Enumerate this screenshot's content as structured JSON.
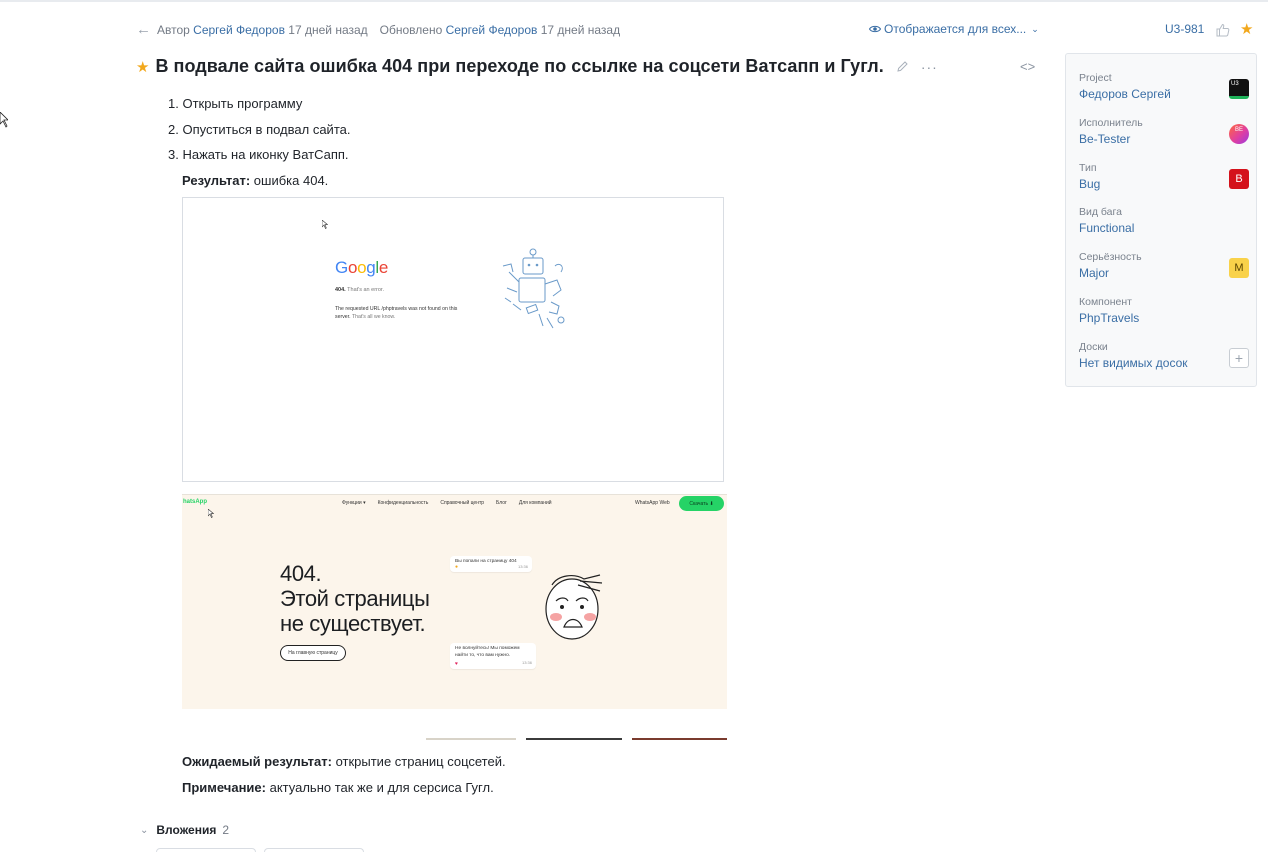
{
  "header": {
    "author_prefix": "Автор",
    "author_name": "Сергей Федоров",
    "author_time": "17 дней назад",
    "updated_prefix": "Обновлено",
    "updated_name": "Сергей Федоров",
    "updated_time": "17 дней назад",
    "visibility": "Отображается для всех...",
    "issue_key": "U3-981"
  },
  "issue": {
    "title": "В подвале сайта ошибка 404 при переходе по ссылке на соцсети Ватсапп и Гугл.",
    "steps": [
      "1. Открыть программу",
      "2. Опуститься в подвал сайта.",
      "3. Нажать на иконку ВатСапп."
    ],
    "result_label": "Результат:",
    "result_text": " ошибка 404.",
    "expected_label": "Ожидаемый результат:",
    "expected_text": " открытие страниц соцсетей.",
    "note_label": "Примечание:",
    "note_text": " актуально так же и для серсиса Гугл."
  },
  "screenshot_google": {
    "logo": [
      "G",
      "o",
      "o",
      "g",
      "l",
      "e"
    ],
    "logo_colors": [
      "#4285f4",
      "#ea4335",
      "#fbbc05",
      "#4285f4",
      "#34a853",
      "#ea4335"
    ],
    "error_code": "404.",
    "error_text": "That's an error.",
    "message_1": "The requested URL /phptravels was not found on this",
    "message_2": "server.",
    "message_3": "That's all we know."
  },
  "screenshot_whatsapp": {
    "logo": "hatsApp",
    "nav": [
      "Функции ▾",
      "Конфиденциальность",
      "Справочный центр",
      "Блог",
      "Для компаний"
    ],
    "web_link": "WhatsApp Web",
    "download": "Скачать ⬇",
    "headline_1": "404.",
    "headline_2": "Этой страницы",
    "headline_3": "не существует.",
    "home_button": "На главную страницу",
    "bubble_1": "Вы попали на страницу 404",
    "bubble_1_time": "13:36",
    "bubble_2": "Не волнуйтесь! Мы поможем найти то, что вам нужно.",
    "bubble_2_time": "13:36"
  },
  "attachments": {
    "label": "Вложения",
    "count": "2"
  },
  "sidebar": {
    "fields": [
      {
        "label": "Project",
        "value": "Федоров Сергей",
        "badge": "U3",
        "badge_kind": "proj"
      },
      {
        "label": "Исполнитель",
        "value": "Be-Tester",
        "badge": "BE",
        "badge_kind": "avatar"
      },
      {
        "label": "Тип",
        "value": "Bug",
        "badge": "B",
        "badge_kind": "bug"
      },
      {
        "label": "Вид бага",
        "value": "Functional",
        "badge": "",
        "badge_kind": "none"
      },
      {
        "label": "Серьёзность",
        "value": "Major",
        "badge": "M",
        "badge_kind": "major"
      },
      {
        "label": "Компонент",
        "value": "PhpTravels",
        "badge": "",
        "badge_kind": "none"
      },
      {
        "label": "Доски",
        "value": "Нет видимых досок",
        "badge": "+",
        "badge_kind": "plus"
      }
    ]
  },
  "colors": {
    "link": "#3a6ea5",
    "star": "#f2a81d",
    "whatsapp_green": "#25d366",
    "whatsapp_bg": "#fcf5eb",
    "bug_red": "#d4121b",
    "major_yellow": "#f9d24a"
  }
}
